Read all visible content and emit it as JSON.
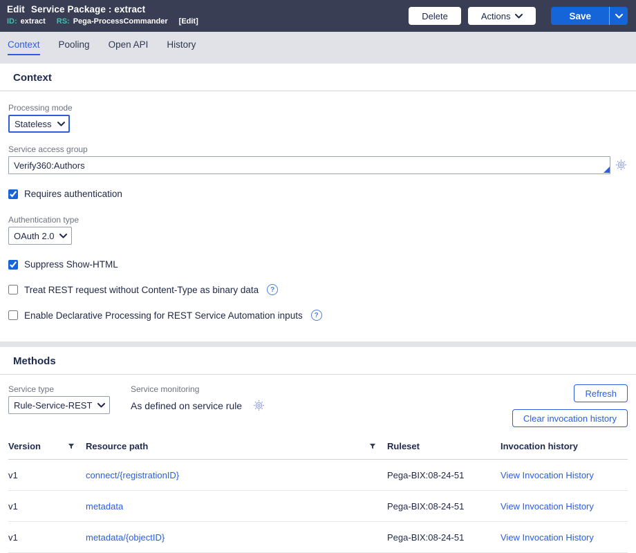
{
  "colors": {
    "header_bg": "#393e54",
    "accent_blue": "#2b5ce6",
    "save_blue": "#1565d8",
    "teal_label": "#45bfae",
    "tabbar_bg": "#e1e2e7"
  },
  "icons": {
    "help": "?",
    "chevron_down": "v",
    "gear": "gear-outline",
    "filter": "funnel",
    "autocomplete": "corner-triangle"
  },
  "header": {
    "mode": "Edit",
    "title": "Service Package : extract",
    "id_label": "ID:",
    "id_value": "extract",
    "rs_label": "RS:",
    "rs_value": "Pega-ProcessCommander",
    "edit_link": "[Edit]",
    "delete_button": "Delete",
    "actions_button": "Actions",
    "save_button": "Save"
  },
  "tabs": [
    {
      "label": "Context",
      "active": true
    },
    {
      "label": "Pooling",
      "active": false
    },
    {
      "label": "Open API",
      "active": false
    },
    {
      "label": "History",
      "active": false
    }
  ],
  "context_section": {
    "heading": "Context",
    "processing_mode": {
      "label": "Processing mode",
      "value": "Stateless"
    },
    "service_access_group": {
      "label": "Service access group",
      "value": "Verify360:Authors"
    },
    "requires_auth": {
      "label": "Requires authentication",
      "checked_attr": "checked"
    },
    "auth_type": {
      "label": "Authentication type",
      "value": "OAuth 2.0"
    },
    "suppress_show_html": {
      "label": "Suppress Show-HTML",
      "checked_attr": "checked"
    },
    "treat_rest_binary": {
      "label": "Treat REST request without Content-Type as binary data"
    },
    "enable_declarative": {
      "label": "Enable Declarative Processing for REST Service Automation inputs"
    }
  },
  "methods_section": {
    "heading": "Methods",
    "service_type": {
      "label": "Service type",
      "value": "Rule-Service-REST"
    },
    "service_monitoring": {
      "label": "Service monitoring",
      "value": "As defined on service rule"
    },
    "refresh_button": "Refresh",
    "clear_button": "Clear invocation history",
    "table": {
      "columns": [
        "Version",
        "Resource path",
        "Ruleset",
        "Invocation history"
      ],
      "rows": [
        {
          "version": "v1",
          "resource_path": "connect/{registrationID}",
          "ruleset": "Pega-BIX:08-24-51",
          "invocation": "View Invocation History"
        },
        {
          "version": "v1",
          "resource_path": "metadata",
          "ruleset": "Pega-BIX:08-24-51",
          "invocation": "View Invocation History"
        },
        {
          "version": "v1",
          "resource_path": "metadata/{objectID}",
          "ruleset": "Pega-BIX:08-24-51",
          "invocation": "View Invocation History"
        }
      ]
    }
  }
}
